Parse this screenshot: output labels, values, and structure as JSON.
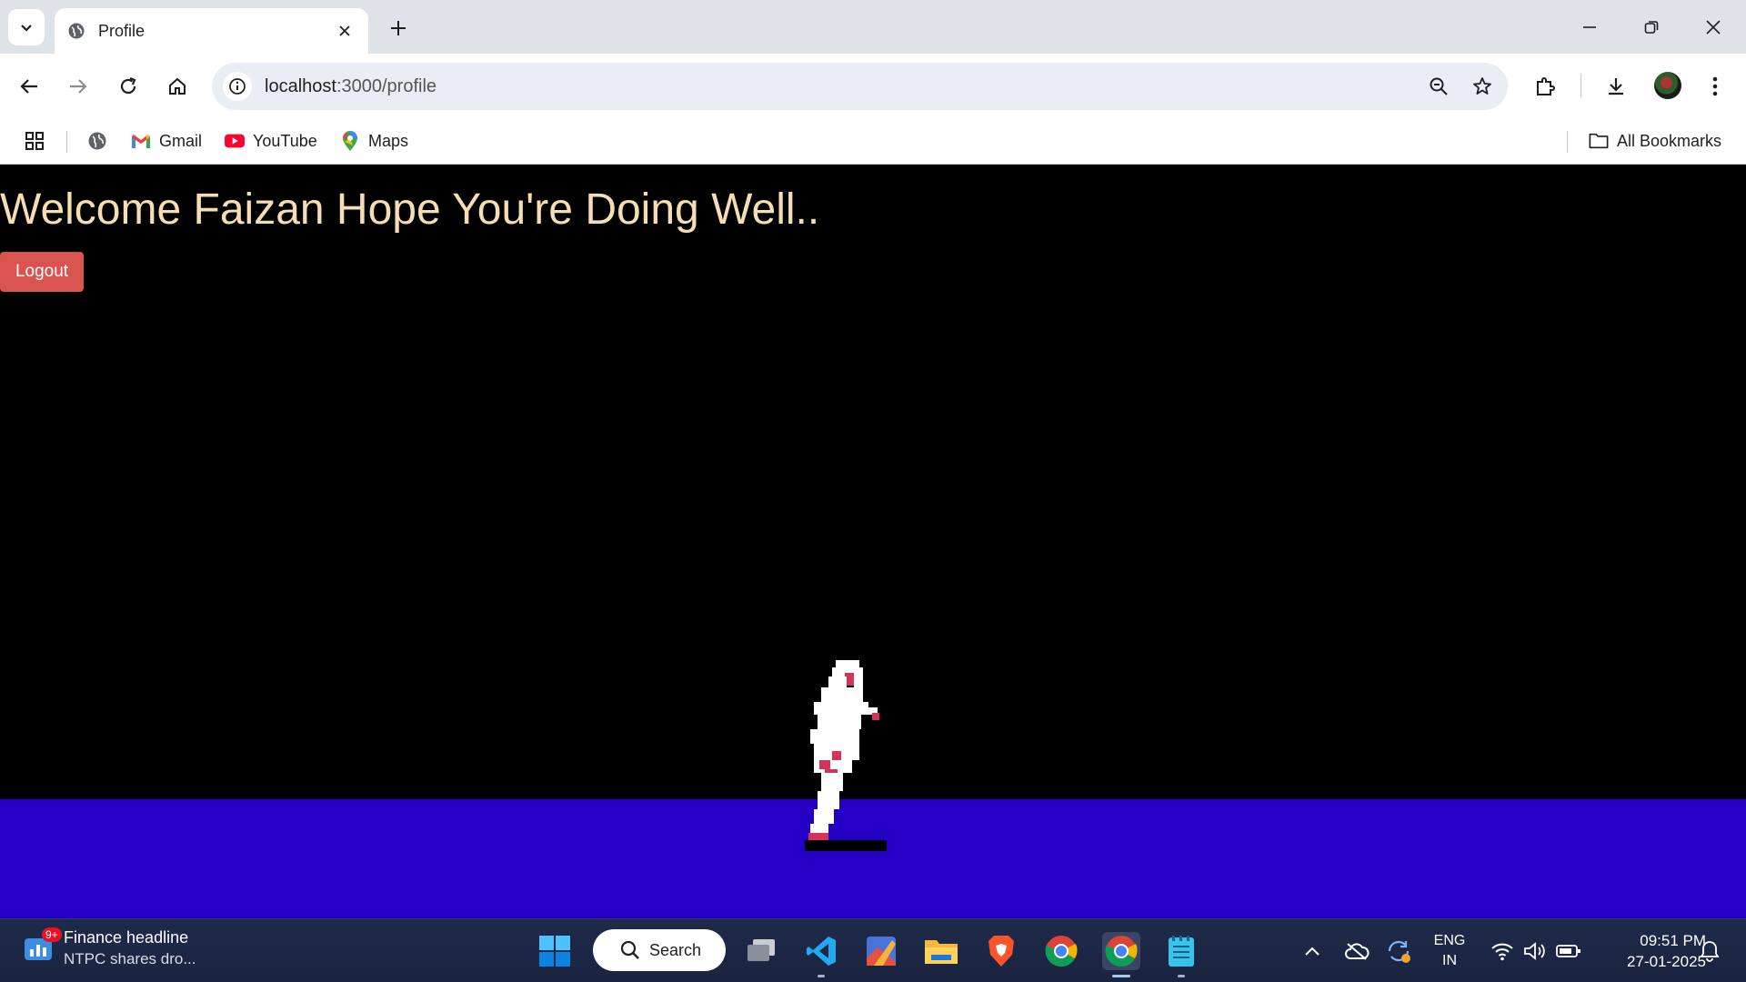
{
  "browser": {
    "tab": {
      "title": "Profile"
    },
    "address": {
      "host": "localhost",
      "path": ":3000/profile"
    },
    "bookmarks": [
      {
        "label": "Gmail"
      },
      {
        "label": "YouTube"
      },
      {
        "label": "Maps"
      }
    ],
    "all_bookmarks_label": "All Bookmarks"
  },
  "page": {
    "heading": "Welcome Faizan Hope You're Doing Well..",
    "logout_label": "Logout",
    "colors": {
      "background": "#000000",
      "ground": "#2400c4",
      "heading": "#f5deb3",
      "logout": "#d9534f"
    }
  },
  "taskbar": {
    "news": {
      "badge": "9+",
      "title": "Finance headline",
      "subtitle": "NTPC shares dro..."
    },
    "search_label": "Search",
    "language": {
      "line1": "ENG",
      "line2": "IN"
    },
    "clock": {
      "time": "09:51 PM",
      "date": "27-01-2025"
    }
  }
}
